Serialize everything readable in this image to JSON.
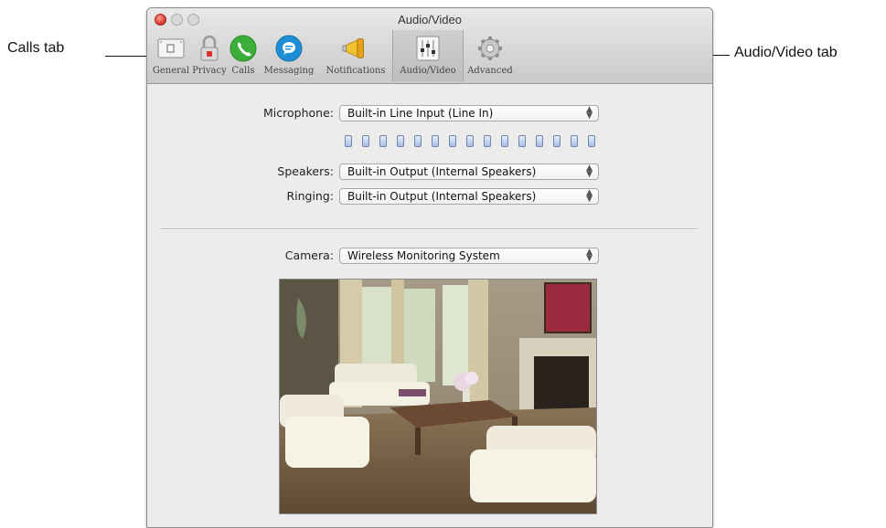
{
  "callouts": {
    "calls_tab": "Calls tab",
    "audio_video_tab": "Audio/Video tab"
  },
  "window": {
    "title": "Audio/Video"
  },
  "toolbar": {
    "items": [
      {
        "label": "General",
        "icon": "general-switch-icon"
      },
      {
        "label": "Privacy",
        "icon": "privacy-lock-icon"
      },
      {
        "label": "Calls",
        "icon": "phone-icon"
      },
      {
        "label": "Messaging",
        "icon": "chat-bubble-icon"
      },
      {
        "label": "Notifications",
        "icon": "megaphone-icon"
      },
      {
        "label": "Audio/Video",
        "icon": "mixer-sliders-icon",
        "selected": true
      },
      {
        "label": "Advanced",
        "icon": "gear-icon"
      }
    ]
  },
  "audio": {
    "microphone_label": "Microphone:",
    "microphone_value": "Built-in Line Input (Line In)",
    "level_segments": 15,
    "speakers_label": "Speakers:",
    "speakers_value": "Built-in Output (Internal Speakers)",
    "ringing_label": "Ringing:",
    "ringing_value": "Built-in Output (Internal Speakers)"
  },
  "video": {
    "camera_label": "Camera:",
    "camera_value": "Wireless Monitoring System"
  },
  "colors": {
    "calls_green": "#3cae3a",
    "messaging_blue": "#1e8fd6",
    "close_red": "#d0342c",
    "window_bg": "#ececec"
  }
}
